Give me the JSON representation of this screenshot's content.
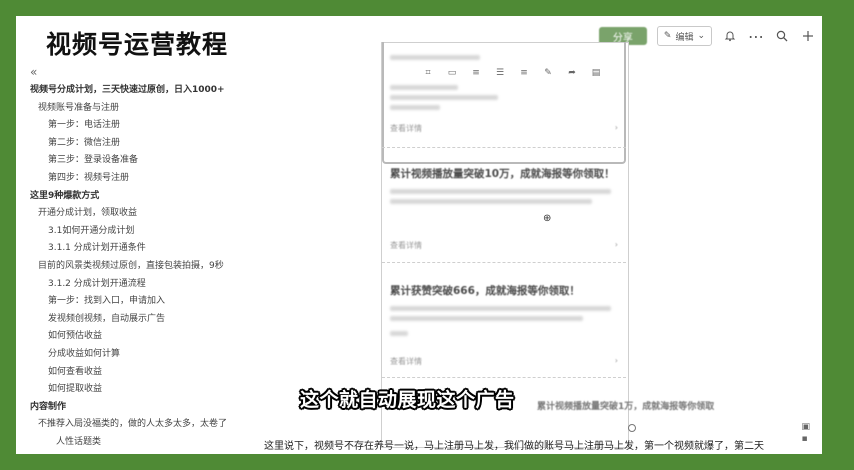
{
  "course_title": "视频号运营教程",
  "toolbar": {
    "share_label": "分享",
    "edit_label": "编辑",
    "icons": [
      "bell-icon",
      "more-icon",
      "search-icon",
      "plus-icon"
    ]
  },
  "toc": [
    {
      "level": 0,
      "label": "视频号分成计划，三天快速过原创，日入1000+"
    },
    {
      "level": 1,
      "label": "视频账号准备与注册"
    },
    {
      "level": 2,
      "label": "第一步：电话注册"
    },
    {
      "level": 2,
      "label": "第二步：微信注册"
    },
    {
      "level": 2,
      "label": "第三步：登录设备准备"
    },
    {
      "level": 2,
      "label": "第四步：视频号注册"
    },
    {
      "level": 0,
      "label": "这里9种爆款方式"
    },
    {
      "level": 1,
      "label": "开通分成计划，领取收益"
    },
    {
      "level": 2,
      "label": "3.1如何开通分成计划"
    },
    {
      "level": 2,
      "label": "3.1.1 分成计划开通条件"
    },
    {
      "level": 1,
      "label": "目前的风景类视频过原创，直接包装拍摄，9秒"
    },
    {
      "level": 2,
      "label": "3.1.2 分成计划开通流程"
    },
    {
      "level": 2,
      "label": "第一步：找到入口，申请加入"
    },
    {
      "level": 2,
      "label": "发视频创视频，自动展示广告"
    },
    {
      "level": 2,
      "label": "如何预估收益"
    },
    {
      "level": 2,
      "label": "分成收益如何计算"
    },
    {
      "level": 2,
      "label": "如何查看收益"
    },
    {
      "level": 2,
      "label": "如何提取收益"
    },
    {
      "level": 0,
      "label": "内容制作"
    },
    {
      "level": 1,
      "label": "不推荐入局没福类的，做的人太多太多，太卷了"
    },
    {
      "level": 3,
      "label": "人性话题类"
    }
  ],
  "cards": [
    {
      "heading": "累计视频播放量突破10万，成就海报等你领取！",
      "footer": "查看详情"
    },
    {
      "heading": "累计获赞突破666，成就海报等你领取！",
      "footer": "查看详情"
    }
  ],
  "top_card_footer": "查看详情",
  "partial_heading": "累计视频播放量突破1万，成就海报等你领取",
  "subtitle": "这个就自动展现这个广告",
  "bottom_caption": "这里说下，视频号不存在养号一说，马上注册马上发，我们做的账号马上注册马上发，第一个视频就爆了，第二天",
  "colors": {
    "background": "#4f8a35",
    "page": "#ffffff",
    "accent_button": "#7aa36b"
  }
}
